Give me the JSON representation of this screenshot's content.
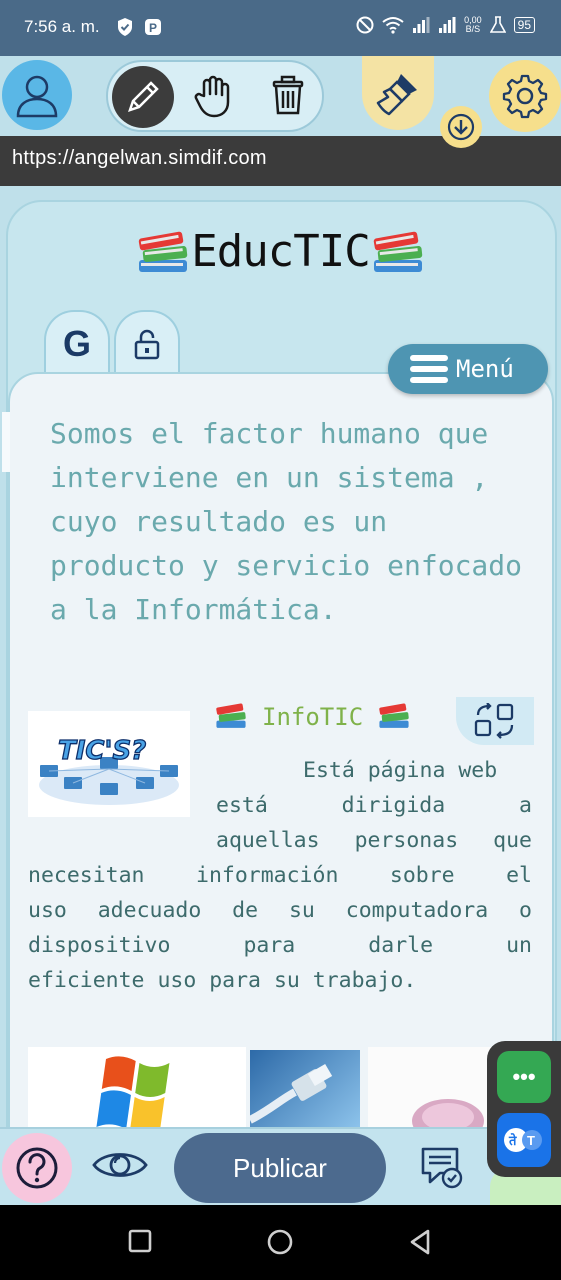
{
  "status_bar": {
    "time": "7:56 a. m.",
    "net_speed_value": "0,00",
    "net_speed_unit": "B/S",
    "battery": "95"
  },
  "toolbar": {
    "icons": [
      "avatar-icon",
      "pencil-icon",
      "hand-icon",
      "trash-icon",
      "paintbrush-icon",
      "download-icon",
      "gear-icon"
    ]
  },
  "url": "https://angelwan.simdif.com",
  "site": {
    "title": "EducTIC",
    "tab_google_label": "G",
    "menu_label": "Menú"
  },
  "intro": "Somos el factor humano que interviene en un sistema , cuyo resultado es un producto y servicio enfocado a la Informática.",
  "info_block": {
    "heading": "InfoTIC",
    "image_text": "TIC'S?",
    "lines": [
      "Está página web",
      "está dirigida a",
      "aquellas personas que",
      "necesitan información sobre el",
      "uso adecuado de su computadora o",
      "dispositivo para darle un",
      "eficiente uso para su trabajo."
    ]
  },
  "bottom_bar": {
    "publish_label": "Publicar"
  },
  "floating_panel": {
    "more_label": "•••",
    "translate_label": "T"
  },
  "colors": {
    "status_bar": "#4a6a88",
    "page_bg": "#bfe0ea",
    "intro_text": "#6aa9ad",
    "body_text": "#3d6b6c",
    "heading_green": "#7fb24a",
    "menu_button": "#4e95b2",
    "publish_button": "#4c6a8e"
  }
}
